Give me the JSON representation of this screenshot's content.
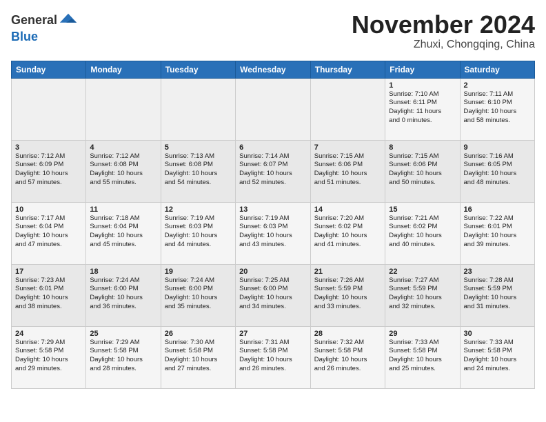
{
  "header": {
    "logo_general": "General",
    "logo_blue": "Blue",
    "month_title": "November 2024",
    "location": "Zhuxi, Chongqing, China"
  },
  "days_of_week": [
    "Sunday",
    "Monday",
    "Tuesday",
    "Wednesday",
    "Thursday",
    "Friday",
    "Saturday"
  ],
  "weeks": [
    [
      {
        "num": "",
        "info": ""
      },
      {
        "num": "",
        "info": ""
      },
      {
        "num": "",
        "info": ""
      },
      {
        "num": "",
        "info": ""
      },
      {
        "num": "",
        "info": ""
      },
      {
        "num": "1",
        "info": "Sunrise: 7:10 AM\nSunset: 6:11 PM\nDaylight: 11 hours\nand 0 minutes."
      },
      {
        "num": "2",
        "info": "Sunrise: 7:11 AM\nSunset: 6:10 PM\nDaylight: 10 hours\nand 58 minutes."
      }
    ],
    [
      {
        "num": "3",
        "info": "Sunrise: 7:12 AM\nSunset: 6:09 PM\nDaylight: 10 hours\nand 57 minutes."
      },
      {
        "num": "4",
        "info": "Sunrise: 7:12 AM\nSunset: 6:08 PM\nDaylight: 10 hours\nand 55 minutes."
      },
      {
        "num": "5",
        "info": "Sunrise: 7:13 AM\nSunset: 6:08 PM\nDaylight: 10 hours\nand 54 minutes."
      },
      {
        "num": "6",
        "info": "Sunrise: 7:14 AM\nSunset: 6:07 PM\nDaylight: 10 hours\nand 52 minutes."
      },
      {
        "num": "7",
        "info": "Sunrise: 7:15 AM\nSunset: 6:06 PM\nDaylight: 10 hours\nand 51 minutes."
      },
      {
        "num": "8",
        "info": "Sunrise: 7:15 AM\nSunset: 6:06 PM\nDaylight: 10 hours\nand 50 minutes."
      },
      {
        "num": "9",
        "info": "Sunrise: 7:16 AM\nSunset: 6:05 PM\nDaylight: 10 hours\nand 48 minutes."
      }
    ],
    [
      {
        "num": "10",
        "info": "Sunrise: 7:17 AM\nSunset: 6:04 PM\nDaylight: 10 hours\nand 47 minutes."
      },
      {
        "num": "11",
        "info": "Sunrise: 7:18 AM\nSunset: 6:04 PM\nDaylight: 10 hours\nand 45 minutes."
      },
      {
        "num": "12",
        "info": "Sunrise: 7:19 AM\nSunset: 6:03 PM\nDaylight: 10 hours\nand 44 minutes."
      },
      {
        "num": "13",
        "info": "Sunrise: 7:19 AM\nSunset: 6:03 PM\nDaylight: 10 hours\nand 43 minutes."
      },
      {
        "num": "14",
        "info": "Sunrise: 7:20 AM\nSunset: 6:02 PM\nDaylight: 10 hours\nand 41 minutes."
      },
      {
        "num": "15",
        "info": "Sunrise: 7:21 AM\nSunset: 6:02 PM\nDaylight: 10 hours\nand 40 minutes."
      },
      {
        "num": "16",
        "info": "Sunrise: 7:22 AM\nSunset: 6:01 PM\nDaylight: 10 hours\nand 39 minutes."
      }
    ],
    [
      {
        "num": "17",
        "info": "Sunrise: 7:23 AM\nSunset: 6:01 PM\nDaylight: 10 hours\nand 38 minutes."
      },
      {
        "num": "18",
        "info": "Sunrise: 7:24 AM\nSunset: 6:00 PM\nDaylight: 10 hours\nand 36 minutes."
      },
      {
        "num": "19",
        "info": "Sunrise: 7:24 AM\nSunset: 6:00 PM\nDaylight: 10 hours\nand 35 minutes."
      },
      {
        "num": "20",
        "info": "Sunrise: 7:25 AM\nSunset: 6:00 PM\nDaylight: 10 hours\nand 34 minutes."
      },
      {
        "num": "21",
        "info": "Sunrise: 7:26 AM\nSunset: 5:59 PM\nDaylight: 10 hours\nand 33 minutes."
      },
      {
        "num": "22",
        "info": "Sunrise: 7:27 AM\nSunset: 5:59 PM\nDaylight: 10 hours\nand 32 minutes."
      },
      {
        "num": "23",
        "info": "Sunrise: 7:28 AM\nSunset: 5:59 PM\nDaylight: 10 hours\nand 31 minutes."
      }
    ],
    [
      {
        "num": "24",
        "info": "Sunrise: 7:29 AM\nSunset: 5:58 PM\nDaylight: 10 hours\nand 29 minutes."
      },
      {
        "num": "25",
        "info": "Sunrise: 7:29 AM\nSunset: 5:58 PM\nDaylight: 10 hours\nand 28 minutes."
      },
      {
        "num": "26",
        "info": "Sunrise: 7:30 AM\nSunset: 5:58 PM\nDaylight: 10 hours\nand 27 minutes."
      },
      {
        "num": "27",
        "info": "Sunrise: 7:31 AM\nSunset: 5:58 PM\nDaylight: 10 hours\nand 26 minutes."
      },
      {
        "num": "28",
        "info": "Sunrise: 7:32 AM\nSunset: 5:58 PM\nDaylight: 10 hours\nand 26 minutes."
      },
      {
        "num": "29",
        "info": "Sunrise: 7:33 AM\nSunset: 5:58 PM\nDaylight: 10 hours\nand 25 minutes."
      },
      {
        "num": "30",
        "info": "Sunrise: 7:33 AM\nSunset: 5:58 PM\nDaylight: 10 hours\nand 24 minutes."
      }
    ]
  ]
}
